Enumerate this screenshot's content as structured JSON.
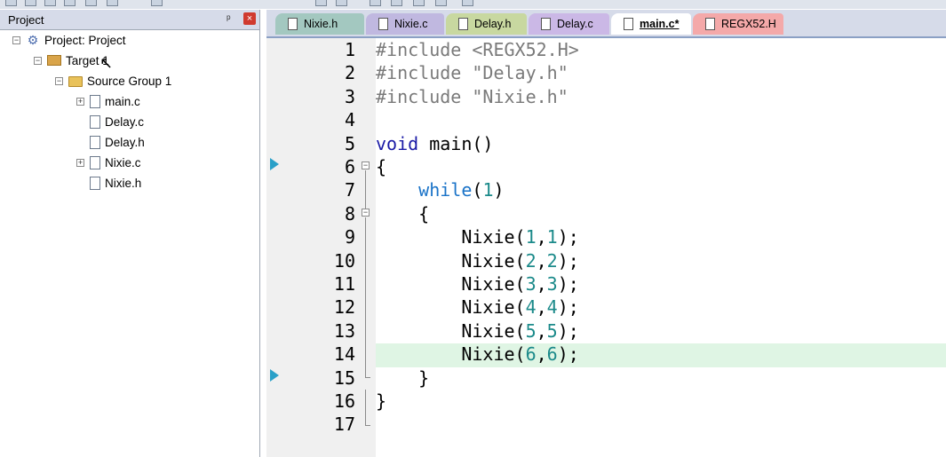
{
  "panel": {
    "title": "Project",
    "pin": "ᵖ",
    "close": "×"
  },
  "tree": [
    {
      "label": "Project: Project",
      "type": "project",
      "level": 0,
      "expander": "−"
    },
    {
      "label": "Target 1",
      "type": "target",
      "level": 1,
      "expander": "−"
    },
    {
      "label": "Source Group 1",
      "type": "folder",
      "level": 2,
      "expander": "−"
    },
    {
      "label": "main.c",
      "type": "file",
      "level": 3,
      "expander": "+"
    },
    {
      "label": "Delay.c",
      "type": "file",
      "level": 3,
      "expander": ""
    },
    {
      "label": "Delay.h",
      "type": "file",
      "level": 3,
      "expander": ""
    },
    {
      "label": "Nixie.c",
      "type": "file",
      "level": 3,
      "expander": "+"
    },
    {
      "label": "Nixie.h",
      "type": "file",
      "level": 3,
      "expander": ""
    }
  ],
  "tabs": [
    {
      "label": "Nixie.h",
      "color": "#a3c8c0",
      "active": false
    },
    {
      "label": "Nixie.c",
      "color": "#c0b8e0",
      "active": false
    },
    {
      "label": "Delay.h",
      "color": "#c8d8a0",
      "active": false
    },
    {
      "label": "Delay.c",
      "color": "#cbb8e6",
      "active": false
    },
    {
      "label": "main.c*",
      "color": "#ffffff",
      "active": true
    },
    {
      "label": "REGX52.H",
      "color": "#f4a9a9",
      "active": false
    }
  ],
  "code": {
    "line_numbers": [
      "1",
      "2",
      "3",
      "4",
      "5",
      "6",
      "7",
      "8",
      "9",
      "10",
      "11",
      "12",
      "13",
      "14",
      "15",
      "16",
      "17"
    ],
    "lines": [
      "#include <REGX52.H>",
      "#include \"Delay.h\"",
      "#include \"Nixie.h\"",
      "",
      "void main()",
      "{",
      "    while(1)",
      "    {",
      "        Nixie(1,1);",
      "        Nixie(2,2);",
      "        Nixie(3,3);",
      "        Nixie(4,4);",
      "        Nixie(5,5);",
      "        Nixie(6,6);",
      "    }",
      "}",
      ""
    ],
    "highlighted_line": 14
  }
}
